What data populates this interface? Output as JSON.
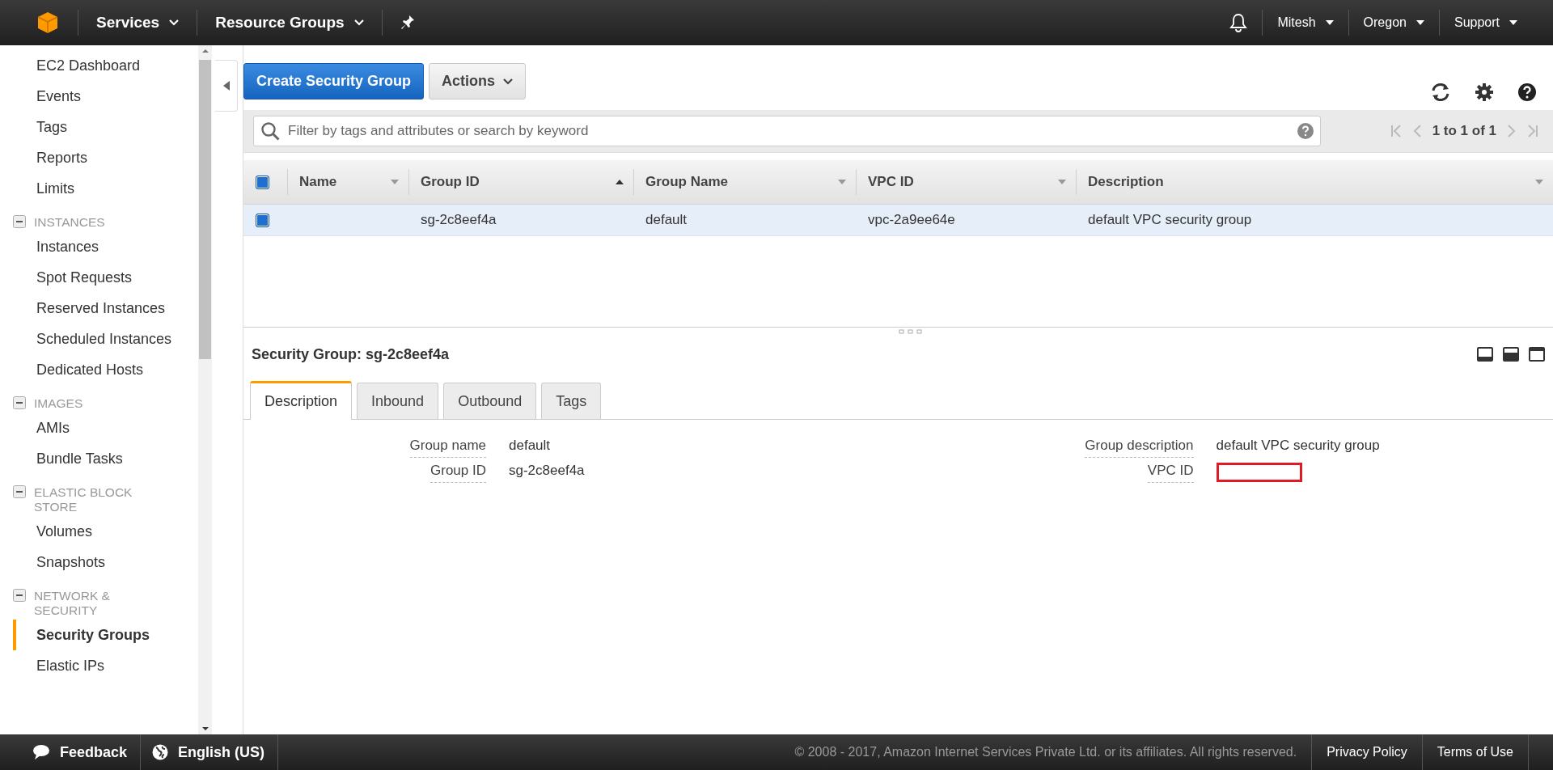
{
  "top_bar": {
    "menus": [
      {
        "label": "Services"
      },
      {
        "label": "Resource Groups"
      }
    ],
    "user_menus": [
      {
        "label": "Mitesh"
      },
      {
        "label": "Oregon"
      },
      {
        "label": "Support"
      }
    ]
  },
  "sidebar": {
    "items": [
      {
        "label": "EC2 Dashboard",
        "selected": false
      },
      {
        "label": "Events",
        "selected": false
      },
      {
        "label": "Tags",
        "selected": false
      },
      {
        "label": "Reports",
        "selected": false
      },
      {
        "label": "Limits",
        "selected": false
      }
    ],
    "sections": [
      {
        "title": "INSTANCES",
        "expanded": true,
        "items": [
          {
            "label": "Instances",
            "selected": false
          },
          {
            "label": "Spot Requests",
            "selected": false
          },
          {
            "label": "Reserved Instances",
            "selected": false
          },
          {
            "label": "Scheduled Instances",
            "selected": false
          },
          {
            "label": "Dedicated Hosts",
            "selected": false
          }
        ]
      },
      {
        "title": "IMAGES",
        "expanded": true,
        "items": [
          {
            "label": "AMIs",
            "selected": false
          },
          {
            "label": "Bundle Tasks",
            "selected": false
          }
        ]
      },
      {
        "title": "ELASTIC BLOCK STORE",
        "expanded": true,
        "items": [
          {
            "label": "Volumes",
            "selected": false
          },
          {
            "label": "Snapshots",
            "selected": false
          }
        ]
      },
      {
        "title": "NETWORK & SECURITY",
        "expanded": true,
        "items": [
          {
            "label": "Security Groups",
            "selected": true
          },
          {
            "label": "Elastic IPs",
            "selected": false
          }
        ]
      }
    ]
  },
  "toolbar": {
    "primary_button": "Create Security Group",
    "actions_button": "Actions"
  },
  "filter": {
    "placeholder": "Filter by tags and attributes or search by keyword",
    "pagination": "1 to 1 of 1"
  },
  "table": {
    "all_selected": true,
    "columns": [
      {
        "label": "Name",
        "sorted": false
      },
      {
        "label": "Group ID",
        "sorted": true
      },
      {
        "label": "Group Name",
        "sorted": false
      },
      {
        "label": "VPC ID",
        "sorted": false
      },
      {
        "label": "Description",
        "sorted": false
      }
    ],
    "rows": [
      {
        "selected": true,
        "cells": [
          null,
          "sg-2c8eef4a",
          "default",
          "vpc-2a9ee64e",
          "default VPC security group"
        ]
      }
    ]
  },
  "details": {
    "title": "Security Group: sg-2c8eef4a",
    "tabs": [
      {
        "label": "Description",
        "selected": true
      },
      {
        "label": "Inbound",
        "selected": false
      },
      {
        "label": "Outbound",
        "selected": false
      },
      {
        "label": "Tags",
        "selected": false
      }
    ],
    "left_fields": [
      {
        "label": "Group name",
        "value": "default",
        "redacted": false
      },
      {
        "label": "Group ID",
        "value": "sg-2c8eef4a",
        "redacted": false
      }
    ],
    "right_fields": [
      {
        "label": "Group description",
        "value": "default VPC security group",
        "redacted": false
      },
      {
        "label": "VPC ID",
        "redacted": true
      }
    ]
  },
  "footer": {
    "feedback": "Feedback",
    "language": "English (US)",
    "copyright": "© 2008 - 2017, Amazon Internet Services Private Ltd. or its affiliates. All rights reserved.",
    "links": [
      "Privacy Policy",
      "Terms of Use"
    ]
  }
}
